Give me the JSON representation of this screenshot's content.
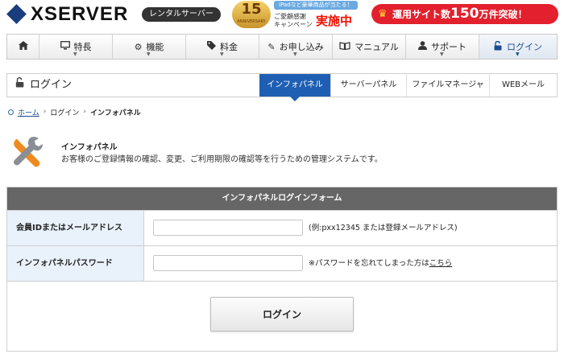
{
  "header": {
    "logo_text": "XSERVER",
    "badge": "レンタルサーバー",
    "anniversary": {
      "number": "15",
      "sub": "ANNIVERSARY",
      "ribbon": "iPadなど豪華商品が当たる！",
      "line1": "ご愛顧感謝",
      "line2": "キャンペーン",
      "big": "実施中"
    },
    "promo": {
      "prefix": "運用サイト数",
      "number": "150",
      "suffix": "万件突破！"
    }
  },
  "nav": {
    "items": [
      {
        "label": "",
        "icon": "home-icon"
      },
      {
        "label": "特長",
        "icon": "monitor-icon"
      },
      {
        "label": "機能",
        "icon": "gear-icon"
      },
      {
        "label": "料金",
        "icon": "tag-icon"
      },
      {
        "label": "お申し込み",
        "icon": "pencil-icon"
      },
      {
        "label": "マニュアル",
        "icon": "book-icon"
      },
      {
        "label": "サポート",
        "icon": "user-icon"
      },
      {
        "label": "ログイン",
        "icon": "unlock-icon"
      }
    ]
  },
  "subnav": {
    "title": "ログイン",
    "tabs": [
      "インフォパネル",
      "サーバーパネル",
      "ファイルマネージャ",
      "WEBメール"
    ]
  },
  "breadcrumb": {
    "home": "ホーム",
    "login": "ログイン",
    "current": "インフォパネル"
  },
  "intro": {
    "title": "インフォパネル",
    "description": "お客様のご登録情報の確認、変更、ご利用期限の確認等を行うための管理システムです。"
  },
  "form": {
    "heading": "インフォパネルログインフォーム",
    "id_label": "会員IDまたはメールアドレス",
    "id_value": "",
    "id_hint": "(例:pxx12345 または登録メールアドレス)",
    "pw_label": "インフォパネルパスワード",
    "pw_value": "",
    "pw_hint": "※パスワードを忘れてしまった方は",
    "pw_hint_link": "こちら",
    "login_button": "ログイン"
  },
  "colors": {
    "brand_blue": "#1f5fb3",
    "promo_red": "#e3202d",
    "form_header": "#666666",
    "label_bg": "#e9f1fa"
  }
}
